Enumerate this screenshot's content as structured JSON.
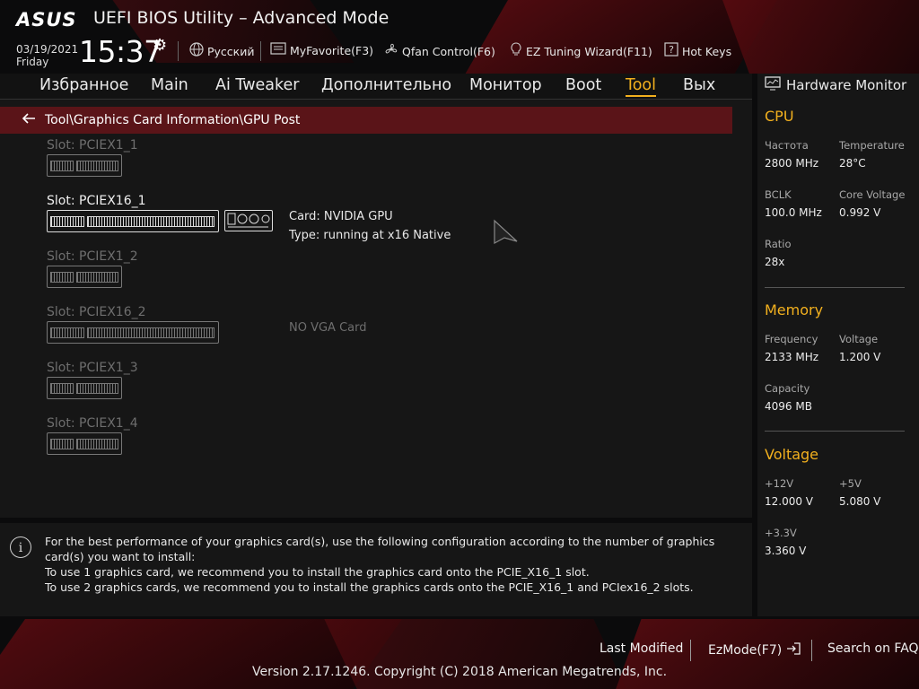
{
  "header": {
    "brand": "ASUS",
    "title": "UEFI BIOS Utility – Advanced Mode",
    "date": "03/19/2021",
    "day": "Friday",
    "time": "15:37",
    "language": "Русский",
    "myfavorite": "MyFavorite(F3)",
    "qfan": "Qfan Control(F6)",
    "ez_tuning": "EZ Tuning Wizard(F11)",
    "hotkeys": "Hot Keys"
  },
  "nav": {
    "tabs": [
      {
        "label": "Избранное"
      },
      {
        "label": "Main"
      },
      {
        "label": "Ai Tweaker"
      },
      {
        "label": "Дополнительно"
      },
      {
        "label": "Монитор"
      },
      {
        "label": "Boot"
      },
      {
        "label": "Tool"
      },
      {
        "label": "Вых"
      }
    ],
    "active": "Tool"
  },
  "breadcrumb": "Tool\\Graphics Card Information\\GPU Post",
  "slots": [
    {
      "label": "Slot: PCIEX1_1"
    },
    {
      "label": "Slot: PCIEX16_1",
      "card": "Card: NVIDIA GPU",
      "type": "Type: running at x16 Native"
    },
    {
      "label": "Slot: PCIEX1_2"
    },
    {
      "label": "Slot: PCIEX16_2",
      "status": "NO VGA Card"
    },
    {
      "label": "Slot: PCIEX1_3"
    },
    {
      "label": "Slot: PCIEX1_4"
    }
  ],
  "info": {
    "line1": "For the best performance of your graphics card(s), use the following configuration according to the number of graphics card(s) you want to install:",
    "line2": "To use 1 graphics card, we recommend you to install  the graphics card onto the PCIE_X16_1 slot.",
    "line3": "To use 2 graphics cards, we recommend you to install the graphics cards onto the PCIE_X16_1 and PCIex16_2 slots."
  },
  "hardware_monitor": {
    "title": "Hardware Monitor",
    "cpu": {
      "title": "CPU",
      "freq_label": "Частота",
      "freq": "2800 MHz",
      "temp_label": "Temperature",
      "temp": "28°C",
      "bclk_label": "BCLK",
      "bclk": "100.0 MHz",
      "corev_label": "Core Voltage",
      "corev": "0.992 V",
      "ratio_label": "Ratio",
      "ratio": "28x"
    },
    "memory": {
      "title": "Memory",
      "freq_label": "Frequency",
      "freq": "2133 MHz",
      "volt_label": "Voltage",
      "volt": "1.200 V",
      "cap_label": "Capacity",
      "cap": "4096 MB"
    },
    "voltage": {
      "title": "Voltage",
      "v12_label": "+12V",
      "v12": "12.000 V",
      "v5_label": "+5V",
      "v5": "5.080 V",
      "v33_label": "+3.3V",
      "v33": "3.360 V"
    }
  },
  "footer": {
    "last_modified": "Last Modified",
    "ezmode": "EzMode(F7)",
    "faq": "Search on FAQ",
    "copyright": "Version 2.17.1246. Copyright (C) 2018 American Megatrends, Inc."
  },
  "colors": {
    "accent": "#f2b01e",
    "crumb_bg": "#5a1418",
    "panel": "#161616"
  }
}
